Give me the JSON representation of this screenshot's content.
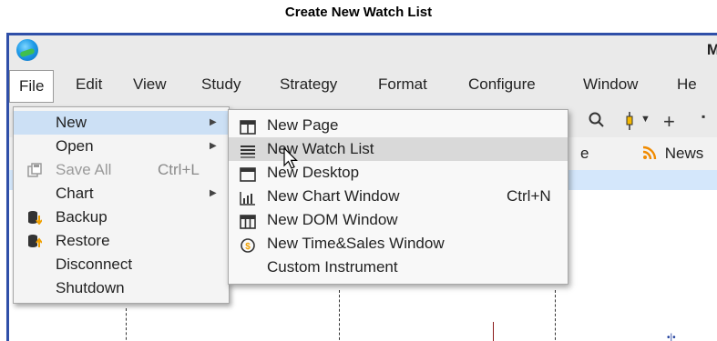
{
  "caption": "Create New Watch List",
  "window": {
    "title_fragment": "M"
  },
  "menubar": {
    "items": [
      {
        "id": "file",
        "label": "File"
      },
      {
        "id": "edit",
        "label": "Edit"
      },
      {
        "id": "view",
        "label": "View"
      },
      {
        "id": "study",
        "label": "Study"
      },
      {
        "id": "strategy",
        "label": "Strategy"
      },
      {
        "id": "format",
        "label": "Format"
      },
      {
        "id": "configure",
        "label": "Configure"
      },
      {
        "id": "window",
        "label": "Window"
      },
      {
        "id": "help",
        "label": "He"
      }
    ]
  },
  "toolbar": {
    "icons": [
      "zoom-icon",
      "candle-icon",
      "dropdown-icon",
      "plus-icon"
    ],
    "row2_fragment": "e",
    "news_label": "News"
  },
  "file_menu": {
    "items": [
      {
        "label": "New",
        "submenu": true,
        "highlighted": true
      },
      {
        "label": "Open",
        "submenu": true
      },
      {
        "label": "Save All",
        "shortcut": "Ctrl+L",
        "disabled": true,
        "icon": "save-all-icon"
      },
      {
        "label": "Chart",
        "submenu": true
      },
      {
        "label": "Backup",
        "icon": "backup-icon"
      },
      {
        "label": "Restore",
        "icon": "restore-icon"
      },
      {
        "label": "Disconnect"
      },
      {
        "label": "Shutdown"
      }
    ]
  },
  "new_submenu": {
    "items": [
      {
        "label": "New Page",
        "icon": "page-icon"
      },
      {
        "label": "New Watch List",
        "icon": "list-icon",
        "highlighted": true
      },
      {
        "label": "New Desktop",
        "icon": "desktop-icon"
      },
      {
        "label": "New Chart Window",
        "shortcut": "Ctrl+N",
        "icon": "bar-chart-icon"
      },
      {
        "label": "New DOM Window",
        "icon": "dom-icon"
      },
      {
        "label": "New Time&Sales Window",
        "icon": "clock-dollar-icon"
      },
      {
        "label": "Custom Instrument"
      }
    ]
  },
  "colors": {
    "frame_border": "#2f4fa8",
    "menu_highlight": "#cce0f5",
    "submenu_highlight": "#d9d9d9",
    "chart_strip": "#d4e7fb",
    "news_icon": "#f08a00"
  }
}
